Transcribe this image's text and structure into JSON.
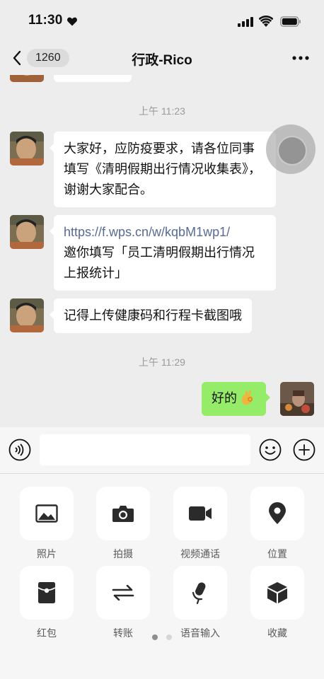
{
  "status_bar": {
    "time": "11:30"
  },
  "nav": {
    "unread_count": "1260",
    "title": "行政-Rico"
  },
  "chat": {
    "timestamps": [
      "上午 11:23",
      "上午 11:29"
    ],
    "messages": [
      {
        "sender": "other",
        "text": "大家好，应防疫要求，请各位同事填写《清明假期出行情况收集表》，谢谢大家配合。"
      },
      {
        "sender": "other",
        "link": "https://f.wps.cn/w/kqbM1wp1/",
        "text": "邀你填写「员工清明假期出行情况上报统计」"
      },
      {
        "sender": "other",
        "text": "记得上传健康码和行程卡截图哦"
      },
      {
        "sender": "self",
        "text": "好的",
        "emoji": "ok-hand-icon"
      }
    ]
  },
  "input": {
    "placeholder": ""
  },
  "tools": [
    {
      "label": "照片",
      "icon": "image-icon"
    },
    {
      "label": "拍摄",
      "icon": "camera-icon"
    },
    {
      "label": "视频通话",
      "icon": "video-icon"
    },
    {
      "label": "位置",
      "icon": "location-pin-icon"
    },
    {
      "label": "红包",
      "icon": "red-packet-icon"
    },
    {
      "label": "转账",
      "icon": "transfer-icon"
    },
    {
      "label": "语音输入",
      "icon": "microphone-icon"
    },
    {
      "label": "收藏",
      "icon": "favorites-box-icon"
    }
  ],
  "pager": {
    "pages": 2,
    "current": 1
  },
  "colors": {
    "background": "#ededed",
    "self_bubble": "#95ec69",
    "link": "#576b95",
    "panel": "#f6f6f6"
  }
}
